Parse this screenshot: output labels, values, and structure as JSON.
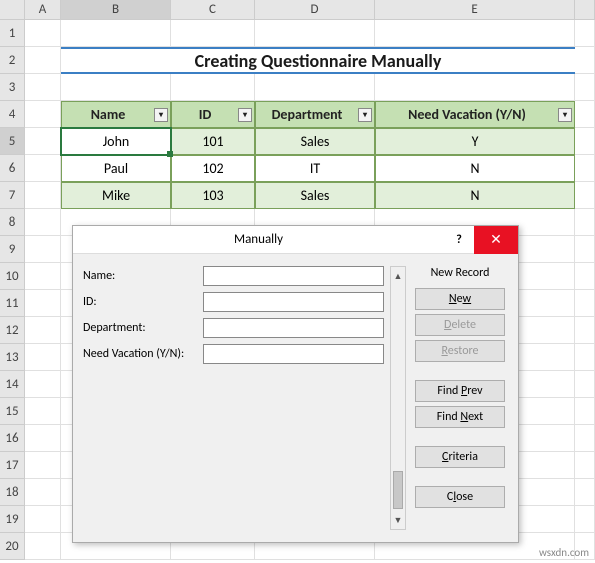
{
  "columns": [
    "A",
    "B",
    "C",
    "D",
    "E"
  ],
  "rows": [
    "1",
    "2",
    "3",
    "4",
    "5",
    "6",
    "7",
    "8",
    "9",
    "10",
    "11",
    "12",
    "13",
    "14",
    "15",
    "16",
    "17",
    "18",
    "19",
    "20"
  ],
  "active_col": "B",
  "active_row": "5",
  "title": "Creating Questionnaire Manually",
  "table": {
    "headers": [
      "Name",
      "ID",
      "Department",
      "Need Vacation (Y/N)"
    ],
    "rows": [
      {
        "name": "John",
        "id": "101",
        "dept": "Sales",
        "vac": "Y"
      },
      {
        "name": "Paul",
        "id": "102",
        "dept": "IT",
        "vac": "N"
      },
      {
        "name": "Mike",
        "id": "103",
        "dept": "Sales",
        "vac": "N"
      }
    ]
  },
  "dialog": {
    "title": "Manually",
    "help": "?",
    "close": "✕",
    "fields": {
      "name": {
        "label": "Name:",
        "value": ""
      },
      "id": {
        "label": "ID:",
        "value": ""
      },
      "dept": {
        "label": "Department:",
        "value": ""
      },
      "vac": {
        "label": "Need Vacation (Y/N):",
        "value": ""
      }
    },
    "rec_label": "New Record",
    "buttons": {
      "new": "New",
      "delete": "Delete",
      "restore": "Restore",
      "findprev": "Find Prev",
      "findnext": "Find Next",
      "criteria": "Criteria",
      "close": "Close"
    }
  },
  "watermark": "wsxdn.com",
  "chart_data": {
    "type": "table",
    "title": "Creating Questionnaire Manually",
    "columns": [
      "Name",
      "ID",
      "Department",
      "Need Vacation (Y/N)"
    ],
    "rows": [
      [
        "John",
        101,
        "Sales",
        "Y"
      ],
      [
        "Paul",
        102,
        "IT",
        "N"
      ],
      [
        "Mike",
        103,
        "Sales",
        "N"
      ]
    ]
  }
}
